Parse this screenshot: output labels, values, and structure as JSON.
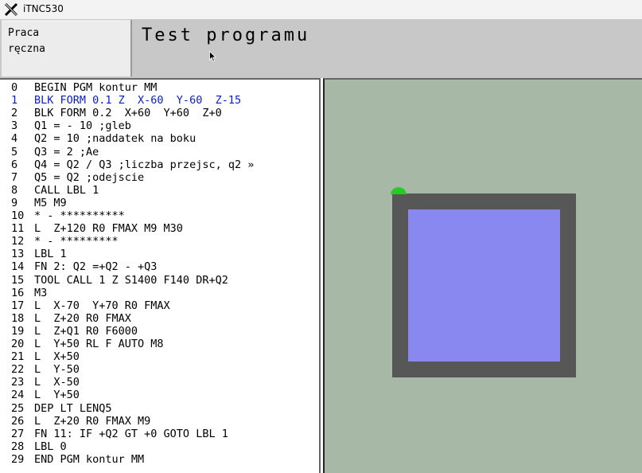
{
  "window": {
    "title": "iTNC530"
  },
  "header": {
    "mode_line1": "Praca",
    "mode_line2": "ręczna",
    "program_title": "Test programu"
  },
  "program": {
    "active_line": 1,
    "lines": [
      {
        "num": "0",
        "text": "BEGIN PGM kontur MM"
      },
      {
        "num": "1",
        "text": "BLK FORM 0.1 Z  X-60  Y-60  Z-15"
      },
      {
        "num": "2",
        "text": "BLK FORM 0.2  X+60  Y+60  Z+0"
      },
      {
        "num": "3",
        "text": "Q1 = - 10 ;gleb"
      },
      {
        "num": "4",
        "text": "Q2 = 10 ;naddatek na boku"
      },
      {
        "num": "5",
        "text": "Q3 = 2 ;Ae"
      },
      {
        "num": "6",
        "text": "Q4 = Q2 / Q3 ;liczba przejsc, q2 »"
      },
      {
        "num": "7",
        "text": "Q5 = Q2 ;odejscie"
      },
      {
        "num": "8",
        "text": "CALL LBL 1"
      },
      {
        "num": "9",
        "text": "M5 M9"
      },
      {
        "num": "10",
        "text": "* - **********"
      },
      {
        "num": "11",
        "text": "L  Z+120 R0 FMAX M9 M30"
      },
      {
        "num": "12",
        "text": "* - *********"
      },
      {
        "num": "13",
        "text": "LBL 1"
      },
      {
        "num": "14",
        "text": "FN 2: Q2 =+Q2 - +Q3"
      },
      {
        "num": "15",
        "text": "TOOL CALL 1 Z S1400 F140 DR+Q2"
      },
      {
        "num": "16",
        "text": "M3"
      },
      {
        "num": "17",
        "text": "L  X-70  Y+70 R0 FMAX"
      },
      {
        "num": "18",
        "text": "L  Z+20 R0 FMAX"
      },
      {
        "num": "19",
        "text": "L  Z+Q1 R0 F6000"
      },
      {
        "num": "20",
        "text": "L  Y+50 RL F AUTO M8"
      },
      {
        "num": "21",
        "text": "L  X+50"
      },
      {
        "num": "22",
        "text": "L  Y-50"
      },
      {
        "num": "23",
        "text": "L  X-50"
      },
      {
        "num": "24",
        "text": "L  Y+50"
      },
      {
        "num": "25",
        "text": "DEP LT LENQ5"
      },
      {
        "num": "26",
        "text": "L  Z+20 R0 FMAX M9"
      },
      {
        "num": "27",
        "text": "FN 11: IF +Q2 GT +0 GOTO LBL 1"
      },
      {
        "num": "28",
        "text": "LBL 0"
      },
      {
        "num": "29",
        "text": "END PGM kontur MM"
      }
    ]
  },
  "graphics": {
    "background_color": "#a7b8a7",
    "blank_color": "#575757",
    "pocket_color": "#8888f0",
    "tool_marker_color": "#22cc22"
  },
  "icons": {
    "app_icon": "x-window-icon",
    "cursor": "mouse-pointer-icon",
    "tool": "tool-position-icon"
  }
}
